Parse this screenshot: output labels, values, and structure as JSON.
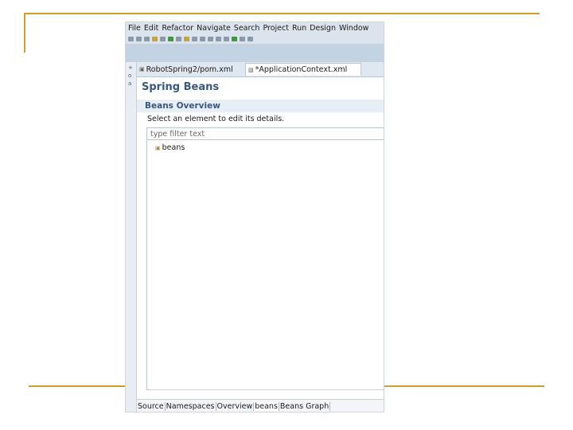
{
  "menu": [
    "File",
    "Edit",
    "Refactor",
    "Navigate",
    "Search",
    "Project",
    "Run",
    "Design",
    "Window"
  ],
  "tabs": [
    {
      "label": "RobotSpring2/pom.xml"
    },
    {
      "label": "*ApplicationContext.xml"
    }
  ],
  "editor": {
    "title": "Spring Beans",
    "section_title": "Beans Overview",
    "section_desc": "Select an element to edit its details.",
    "filter_placeholder": "type filter text",
    "tree": [
      {
        "label": "beans"
      }
    ]
  },
  "bottom_tabs": [
    "Source",
    "Namespaces",
    "Overview",
    "beans",
    "Beans Graph"
  ],
  "colors": {
    "slide_accent": "#c9a227",
    "title_blue": "#39577f"
  }
}
